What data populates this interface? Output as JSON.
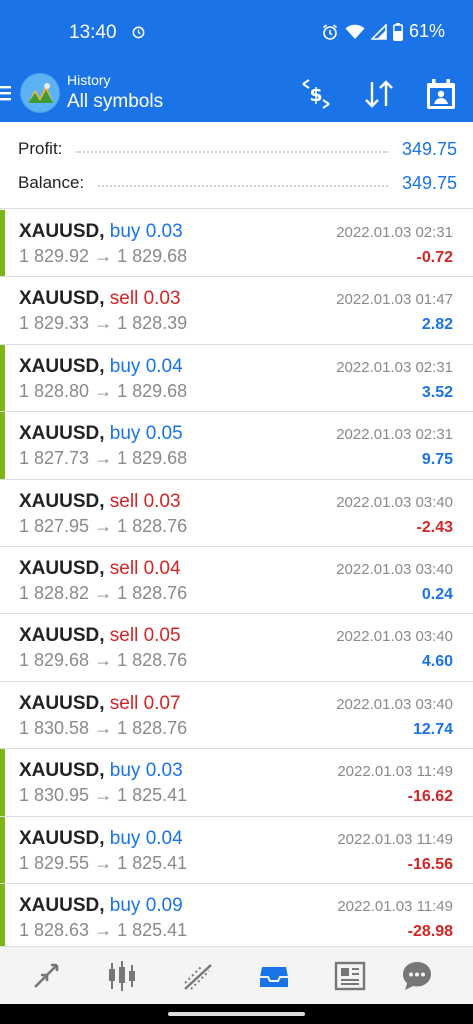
{
  "status_bar": {
    "time": "13:40",
    "battery": "61%",
    "icons": [
      "alarm-icon",
      "wifi-icon",
      "signal-icon",
      "battery-icon"
    ]
  },
  "app_bar": {
    "subtitle": "History",
    "title": "All symbols",
    "actions": [
      "currency-filter-icon",
      "sort-icon",
      "calendar-icon"
    ]
  },
  "summary": {
    "profit_label": "Profit:",
    "profit_value": "349.75",
    "balance_label": "Balance:",
    "balance_value": "349.75"
  },
  "deals": [
    {
      "symbol": "XAUUSD,",
      "side": "buy 0.03",
      "type": "buy",
      "prices": "1 829.92 → 1 829.68",
      "time": "2022.01.03 02:31",
      "profit": "-0.72"
    },
    {
      "symbol": "XAUUSD,",
      "side": "sell 0.03",
      "type": "sell",
      "prices": "1 829.33 → 1 828.39",
      "time": "2022.01.03 01:47",
      "profit": "2.82"
    },
    {
      "symbol": "XAUUSD,",
      "side": "buy 0.04",
      "type": "buy",
      "prices": "1 828.80 → 1 829.68",
      "time": "2022.01.03 02:31",
      "profit": "3.52"
    },
    {
      "symbol": "XAUUSD,",
      "side": "buy 0.05",
      "type": "buy",
      "prices": "1 827.73 → 1 829.68",
      "time": "2022.01.03 02:31",
      "profit": "9.75"
    },
    {
      "symbol": "XAUUSD,",
      "side": "sell 0.03",
      "type": "sell",
      "prices": "1 827.95 → 1 828.76",
      "time": "2022.01.03 03:40",
      "profit": "-2.43"
    },
    {
      "symbol": "XAUUSD,",
      "side": "sell 0.04",
      "type": "sell",
      "prices": "1 828.82 → 1 828.76",
      "time": "2022.01.03 03:40",
      "profit": "0.24"
    },
    {
      "symbol": "XAUUSD,",
      "side": "sell 0.05",
      "type": "sell",
      "prices": "1 829.68 → 1 828.76",
      "time": "2022.01.03 03:40",
      "profit": "4.60"
    },
    {
      "symbol": "XAUUSD,",
      "side": "sell 0.07",
      "type": "sell",
      "prices": "1 830.58 → 1 828.76",
      "time": "2022.01.03 03:40",
      "profit": "12.74"
    },
    {
      "symbol": "XAUUSD,",
      "side": "buy 0.03",
      "type": "buy",
      "prices": "1 830.95 → 1 825.41",
      "time": "2022.01.03 11:49",
      "profit": "-16.62"
    },
    {
      "symbol": "XAUUSD,",
      "side": "buy 0.04",
      "type": "buy",
      "prices": "1 829.55 → 1 825.41",
      "time": "2022.01.03 11:49",
      "profit": "-16.56"
    },
    {
      "symbol": "XAUUSD,",
      "side": "buy 0.09",
      "type": "buy",
      "prices": "1 828.63 → 1 825.41",
      "time": "2022.01.03 11:49",
      "profit": "-28.98"
    }
  ],
  "bottom_nav": [
    "quotes-icon",
    "chart-icon",
    "trade-icon",
    "history-icon",
    "news-icon",
    "chat-icon"
  ],
  "colors": {
    "accent": "#1a74e8",
    "buy_bar": "#7cb518",
    "negative": "#d32525",
    "muted": "#8a8a8a"
  }
}
